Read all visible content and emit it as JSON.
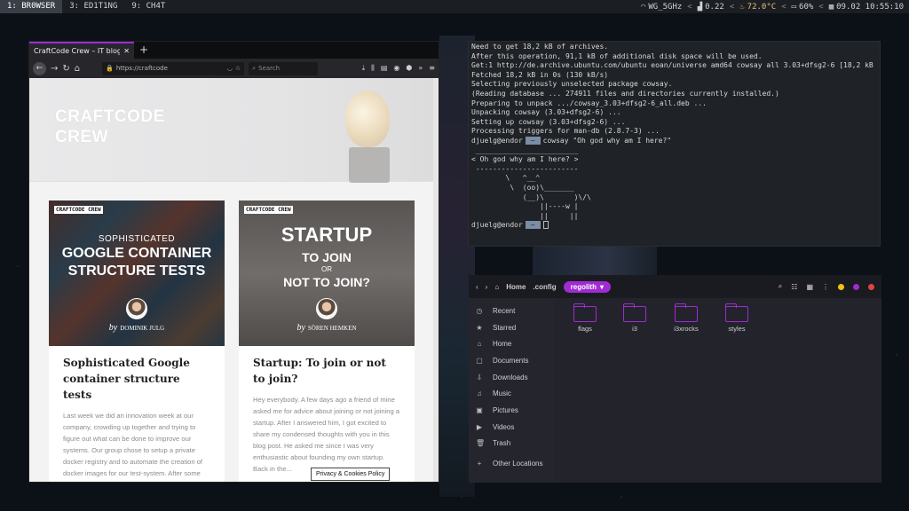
{
  "topbar": {
    "workspaces": [
      "1: BR0WSER",
      "3: ED1T1NG",
      "9: CH4T"
    ],
    "wifi": "WG_5GHz",
    "load": "0.22",
    "temp": "72.0°C",
    "battery": "60%",
    "datetime": "09.02 10:55:10",
    "sep": "<"
  },
  "browser": {
    "tab_title": "CraftCode Crew – IT blog",
    "url": "https://craftcode",
    "search_placeholder": "Search",
    "hero_title": "CRAFTCODE\nCREW",
    "cookie_button": "Privacy & Cookies Policy",
    "cards": [
      {
        "badge": "CRAFTCODE CREW",
        "img_small": "SOPHISTICATED",
        "img_big": "GOOGLE CONTAINER\nSTRUCTURE TESTS",
        "byline_by": "by",
        "byline_name": "DOMINIK JULG",
        "title": "Sophisticated Google container structure tests",
        "excerpt": "Last week we did an innovation week at our company, crowding up together and trying to figure out what can be done to improve our systems. Our group chose to setup a private docker registry and to automate the creation of docker images for our test-system. After some research we came up with Google's framework..."
      },
      {
        "badge": "CRAFTCODE CREW",
        "img_big": "STARTUP",
        "img_mid": "TO JOIN",
        "img_or": "OR",
        "img_mid2": "NOT TO JOIN?",
        "byline_by": "by",
        "byline_name": "SÖREN HEMKEN",
        "title": "Startup: To join or not to join?",
        "excerpt": "Hey everybody. A few days ago a friend of mine asked me for advice about joining or not joining a startup. After I answered him, I got excited to share my condensed thoughts with you in this blog post. He asked me since I was very enthusiastic about founding my own startup. Back in the..."
      }
    ]
  },
  "terminal": {
    "lines_before": [
      "Need to get 18,2 kB of archives.",
      "After this operation, 91,1 kB of additional disk space will be used.",
      "Get:1 http://de.archive.ubuntu.com/ubuntu eoan/universe amd64 cowsay all 3.03+dfsg2-6 [18,2 kB",
      "Fetched 18,2 kB in 0s (130 kB/s)",
      "Selecting previously unselected package cowsay.",
      "(Reading database ... 274911 files and directories currently installed.)",
      "Preparing to unpack .../cowsay_3.03+dfsg2-6_all.deb ...",
      "Unpacking cowsay (3.03+dfsg2-6) ...",
      "Setting up cowsay (3.03+dfsg2-6) ...",
      "Processing triggers for man-db (2.8.7-3) ..."
    ],
    "prompt_host": "djuelg@endor",
    "prompt_arrow": "~",
    "command": "cowsay \"Oh god why am I here?\"",
    "cow_lines": [
      " ________________________",
      "< Oh god why am I here? >",
      " ------------------------",
      "        \\   ^__^",
      "         \\  (oo)\\_______",
      "            (__)\\       )\\/\\",
      "                ||----w |",
      "                ||     ||"
    ]
  },
  "files": {
    "path": [
      "Home",
      ".config"
    ],
    "active": "regolith",
    "sidebar": [
      {
        "icon": "◷",
        "label": "Recent"
      },
      {
        "icon": "★",
        "label": "Starred"
      },
      {
        "icon": "⌂",
        "label": "Home"
      },
      {
        "icon": "▢",
        "label": "Documents"
      },
      {
        "icon": "⇩",
        "label": "Downloads"
      },
      {
        "icon": "♫",
        "label": "Music"
      },
      {
        "icon": "▣",
        "label": "Pictures"
      },
      {
        "icon": "▶",
        "label": "Videos"
      },
      {
        "icon": "🗑",
        "label": "Trash"
      },
      {
        "icon": "+",
        "label": "Other Locations"
      }
    ],
    "folders": [
      "flags",
      "i3",
      "i3xrocks",
      "styles"
    ],
    "dot_colors": [
      "#f5c211",
      "#9f2bd1",
      "#e0443e"
    ]
  }
}
